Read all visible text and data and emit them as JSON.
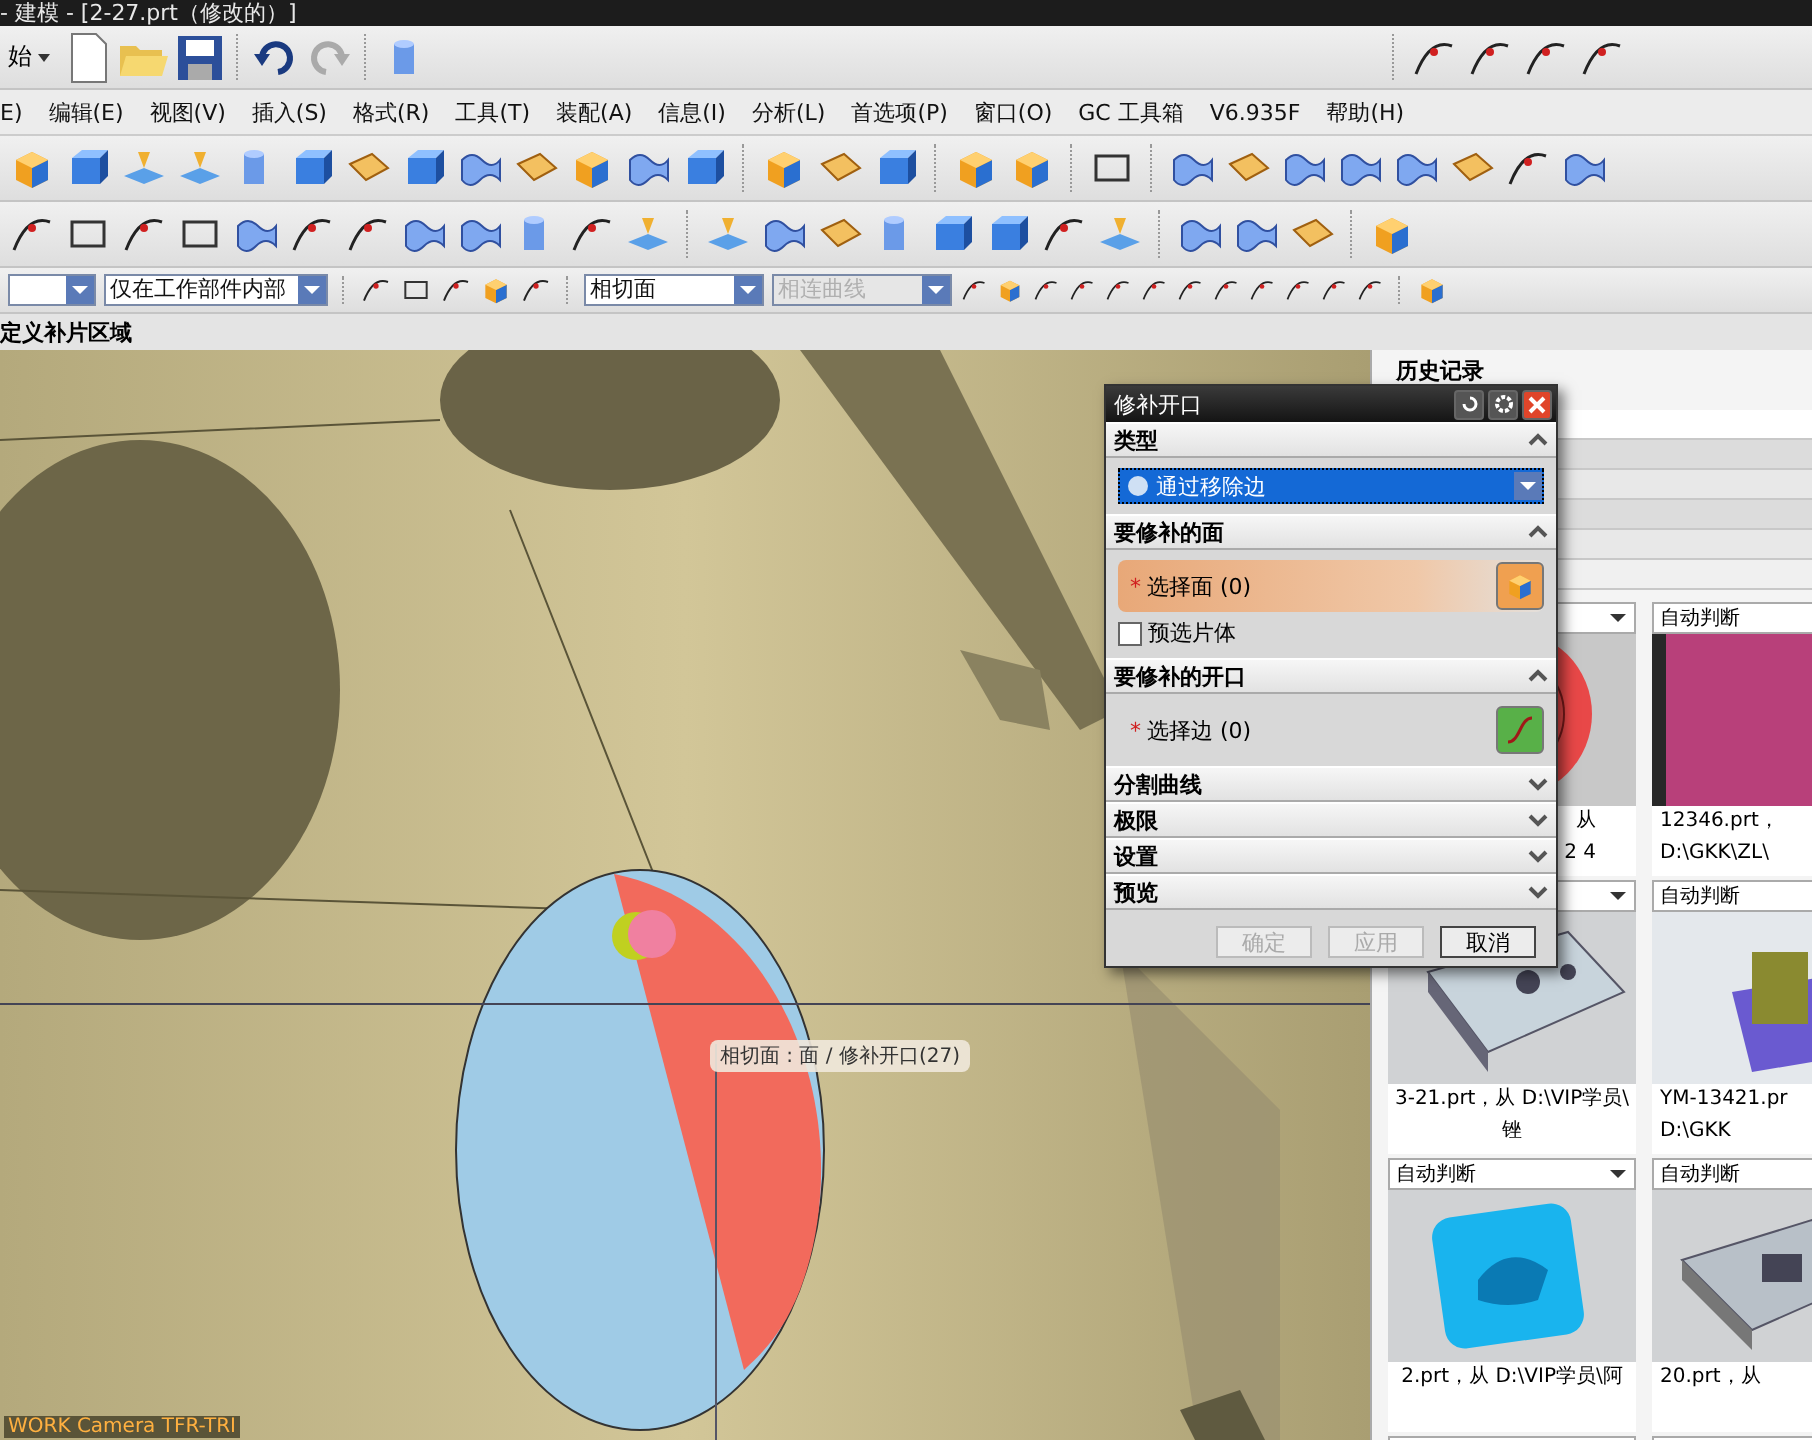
{
  "window": {
    "title": "- 建模 - [2-27.prt（修改的）]"
  },
  "start_button": {
    "label": "始"
  },
  "menu": [
    "E)",
    "编辑(E)",
    "视图(V)",
    "插入(S)",
    "格式(R)",
    "工具(T)",
    "装配(A)",
    "信息(I)",
    "分析(L)",
    "首选项(P)",
    "窗口(O)",
    "GC 工具箱",
    "V6.935F",
    "帮助(H)"
  ],
  "selection_bar": {
    "dropdowns": [
      {
        "disabled": false
      },
      {
        "value": "仅在工作部件内部",
        "disabled": false
      }
    ],
    "curve_rule": {
      "value": "相切面",
      "disabled": false
    },
    "chain_rule": {
      "value": "相连曲线",
      "disabled": true
    }
  },
  "cue_line": "定义补片区域",
  "viewport": {
    "tooltip": "相切面 : 面 / 修补开口(27)",
    "camera_label": "WORK Camera TFR-TRI"
  },
  "dialog": {
    "title": "修补开口",
    "sections": [
      {
        "title": "类型",
        "expanded": true,
        "kind": "dropdown",
        "value": "通过移除边"
      },
      {
        "title": "要修补的面",
        "expanded": true,
        "kind": "face-select",
        "marker": "*",
        "label": "选择面 (0)",
        "highlighted": true,
        "checkbox": {
          "label": "预选片体",
          "checked": false
        }
      },
      {
        "title": "要修补的开口",
        "expanded": true,
        "kind": "edge-select",
        "marker": "*",
        "label": "选择边 (0)",
        "highlighted": false
      },
      {
        "title": "分割曲线",
        "expanded": false
      },
      {
        "title": "极限",
        "expanded": false
      },
      {
        "title": "设置",
        "expanded": false
      },
      {
        "title": "预览",
        "expanded": false
      }
    ],
    "buttons": [
      {
        "label": "确定",
        "disabled": true
      },
      {
        "label": "应用",
        "disabled": true
      },
      {
        "label": "取消",
        "disabled": false
      }
    ]
  },
  "history": {
    "title": "历史记录",
    "cards": [
      {
        "caption": [
          "从",
          "2 4"
        ],
        "kind": "red-part"
      },
      {
        "header": "自动判断",
        "caption": [
          "12346.prt，",
          "D:\\GKK\\ZL\\"
        ],
        "kind": "magenta-block"
      },
      {
        "caption": [
          "3-21.prt，从 D:\\VIP学员\\",
          "锉"
        ],
        "kind": "plate"
      },
      {
        "header": "自动判断",
        "caption": [
          "YM-13421.pr",
          "D:\\GKK"
        ],
        "kind": "assembly"
      },
      {
        "header": "自动判断",
        "caption": [
          "2.prt，从 D:\\VIP学员\\阿"
        ],
        "kind": "cavity"
      },
      {
        "header": "自动判断",
        "caption": [
          "20.prt，从"
        ],
        "kind": "mold"
      }
    ]
  }
}
